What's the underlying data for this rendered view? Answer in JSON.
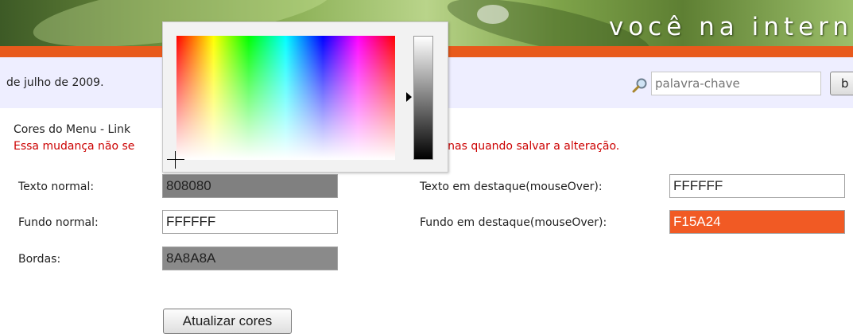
{
  "banner": {
    "logo_text": "você na intern"
  },
  "info_bar": {
    "date_text": "de julho de 2009.",
    "search": {
      "placeholder": "palavra-chave",
      "button_label": "b"
    }
  },
  "section": {
    "title": "Cores do Menu - Link",
    "warning": "Essa mudança não se",
    "warning_tail": "cor. Apenas quando salvar a alteração."
  },
  "fields": {
    "texto_normal": {
      "label": "Texto normal:",
      "value": "808080",
      "bg": "#808080",
      "color": "#222222"
    },
    "fundo_normal": {
      "label": "Fundo normal:",
      "value": "FFFFFF",
      "bg": "#FFFFFF",
      "color": "#222222"
    },
    "bordas": {
      "label": "Bordas:",
      "value": "8A8A8A",
      "bg": "#8A8A8A",
      "color": "#222222"
    },
    "texto_destaque": {
      "label": "Texto em destaque(mouseOver):",
      "value": "FFFFFF",
      "bg": "#FFFFFF",
      "color": "#222222"
    },
    "fundo_destaque": {
      "label": "Fundo em destaque(mouseOver):",
      "value": "F15A24",
      "bg": "#F15A24",
      "color": "#FFFFFF"
    }
  },
  "actions": {
    "update_label": "Atualizar cores"
  },
  "colors": {
    "accent": "#E85A1C",
    "warning": "#CC0000",
    "info_bar": "#EEEEFF"
  }
}
